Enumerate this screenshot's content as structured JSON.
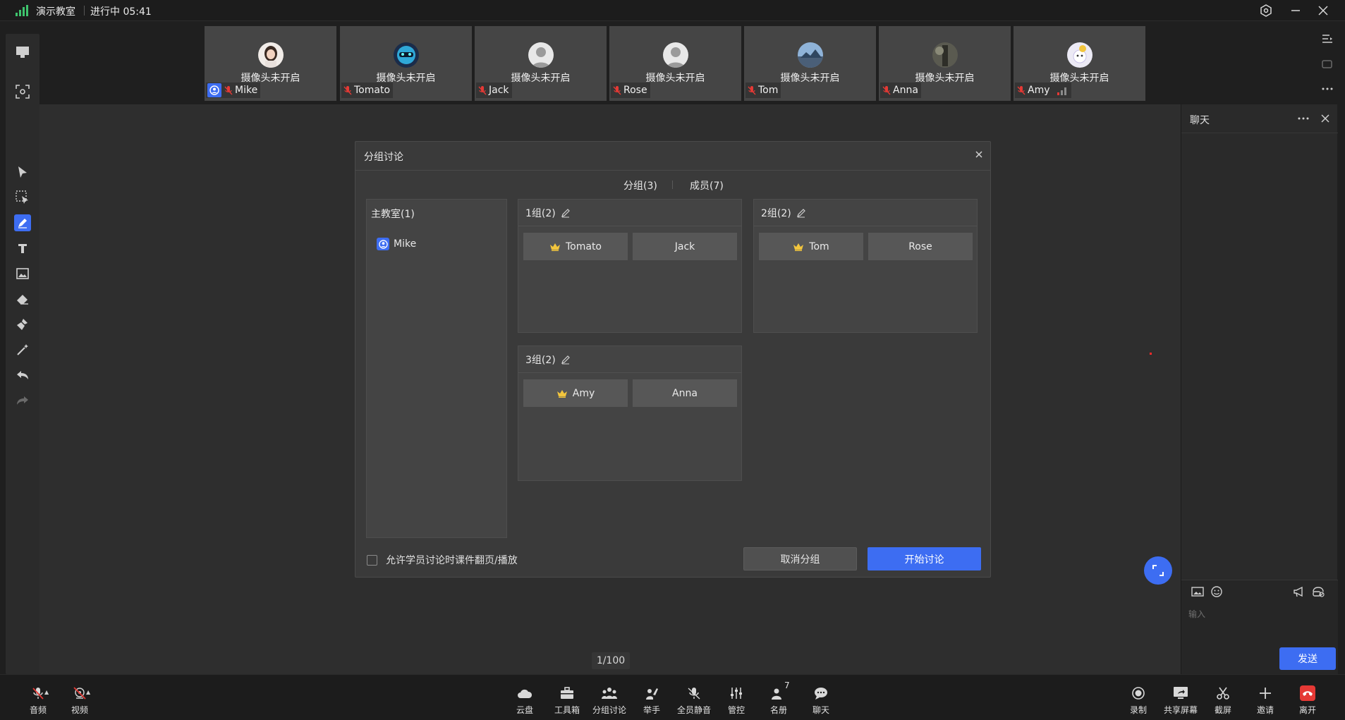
{
  "topbar": {
    "room_name": "演示教室",
    "status": "进行中 05:41"
  },
  "video_tiles": [
    {
      "name": "Mike",
      "camera_status": "摄像头未开启",
      "avatar": "photo-girl",
      "is_host": true
    },
    {
      "name": "Tomato",
      "camera_status": "摄像头未开启",
      "avatar": "blue-robot"
    },
    {
      "name": "Jack",
      "camera_status": "摄像头未开启",
      "avatar": "default-user"
    },
    {
      "name": "Rose",
      "camera_status": "摄像头未开启",
      "avatar": "default-user"
    },
    {
      "name": "Tom",
      "camera_status": "摄像头未开启",
      "avatar": "landscape-photo"
    },
    {
      "name": "Anna",
      "camera_status": "摄像头未开启",
      "avatar": "dark-photo"
    },
    {
      "name": "Amy",
      "camera_status": "摄像头未开启",
      "avatar": "cartoon",
      "signal_bars": true
    }
  ],
  "chat": {
    "title": "聊天",
    "input_placeholder": "输入",
    "send_label": "发送"
  },
  "dialog": {
    "title": "分组讨论",
    "tabs": [
      "分组(3)",
      "成员(7)"
    ],
    "main_room": {
      "title": "主教室(1)",
      "members": [
        "Mike"
      ]
    },
    "groups": [
      {
        "title": "1组(2)",
        "leader": "Tomato",
        "member": "Jack"
      },
      {
        "title": "2组(2)",
        "leader": "Tom",
        "member": "Rose"
      },
      {
        "title": "3组(2)",
        "leader": "Amy",
        "member": "Anna"
      }
    ],
    "allow_label": "允许学员讨论时课件翻页/播放",
    "allow_checked": false,
    "cancel_label": "取消分组",
    "start_label": "开始讨论"
  },
  "page_counter": "1/100",
  "bottom_bar": {
    "left": [
      {
        "label": "音频",
        "icon": "mic-off-icon"
      },
      {
        "label": "视频",
        "icon": "camera-off-icon"
      }
    ],
    "center": [
      {
        "label": "云盘",
        "icon": "cloud-icon"
      },
      {
        "label": "工具箱",
        "icon": "toolbox-icon"
      },
      {
        "label": "分组讨论",
        "icon": "group-icon"
      },
      {
        "label": "举手",
        "icon": "raise-hand-icon"
      },
      {
        "label": "全员静音",
        "icon": "mute-all-icon"
      },
      {
        "label": "管控",
        "icon": "controls-icon"
      },
      {
        "label": "名册",
        "icon": "roster-icon",
        "badge": "7"
      },
      {
        "label": "聊天",
        "icon": "chat-icon"
      }
    ],
    "right": [
      {
        "label": "录制",
        "icon": "record-icon"
      },
      {
        "label": "共享屏幕",
        "icon": "share-screen-icon"
      },
      {
        "label": "截屏",
        "icon": "screenshot-icon"
      },
      {
        "label": "邀请",
        "icon": "invite-icon"
      },
      {
        "label": "离开",
        "icon": "leave-icon",
        "color": "#e53935"
      }
    ]
  },
  "colors": {
    "accent": "#3d6df2",
    "crown": "#f2c53d",
    "leave": "#e53935",
    "mic_off": "#e53935"
  }
}
